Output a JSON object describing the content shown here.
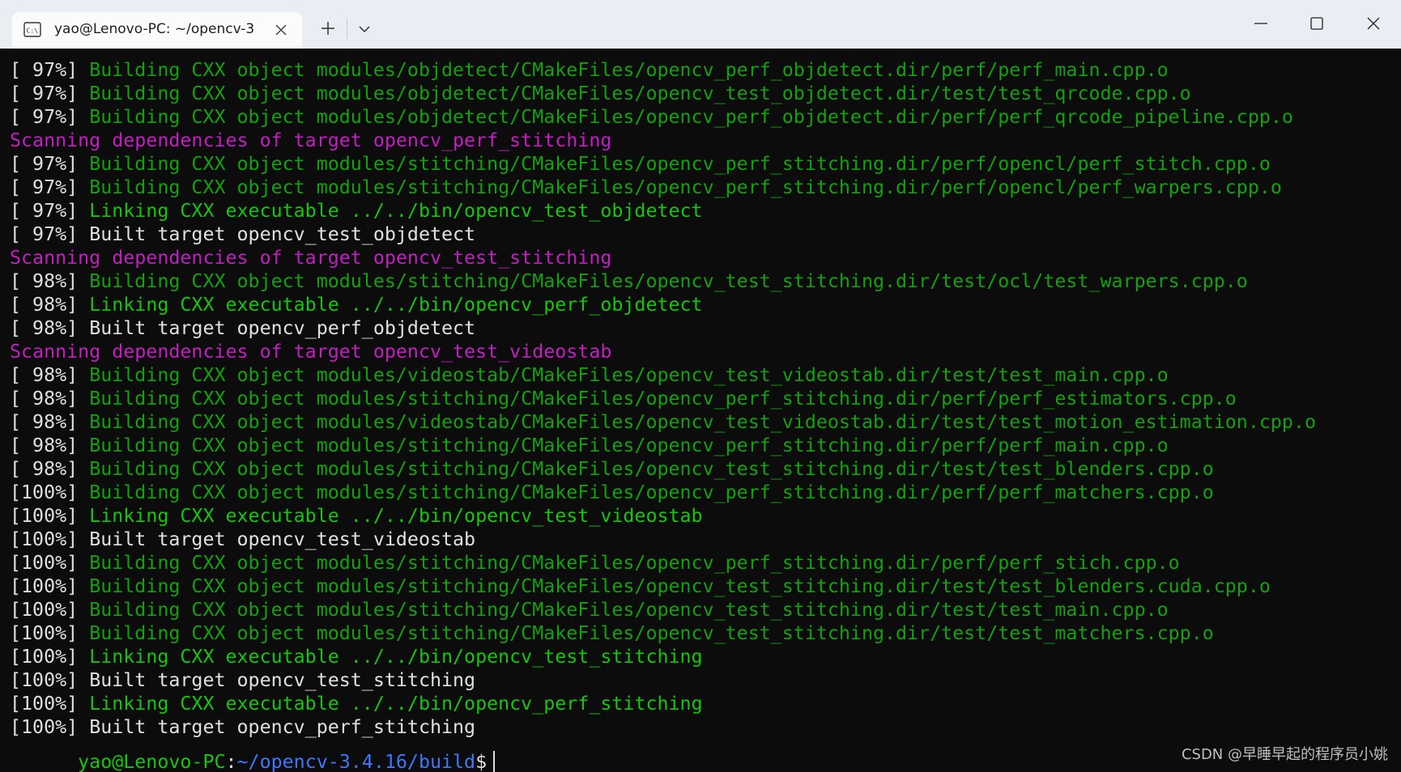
{
  "window": {
    "tab_title": "yao@Lenovo-PC: ~/opencv-3",
    "tab_icon": "terminal-icon",
    "new_tab_icon": "plus-icon",
    "dropdown_icon": "chevron-down-icon",
    "minimize_icon": "minimize-icon",
    "maximize_icon": "maximize-icon",
    "close_icon": "close-icon"
  },
  "colors": {
    "background": "#0c0c0c",
    "text_white": "#e0e0e0",
    "text_green": "#16c60c",
    "text_magenta": "#c21ec2",
    "path_blue": "#3b78ff",
    "titlebar": "#e8eef3"
  },
  "terminal": {
    "lines": [
      {
        "prefix": "[ 97%] ",
        "text": "Building CXX object modules/objdetect/CMakeFiles/opencv_perf_objdetect.dir/perf/perf_main.cpp.o",
        "style": "build"
      },
      {
        "prefix": "[ 97%] ",
        "text": "Building CXX object modules/objdetect/CMakeFiles/opencv_test_objdetect.dir/test/test_qrcode.cpp.o",
        "style": "build"
      },
      {
        "prefix": "[ 97%] ",
        "text": "Building CXX object modules/objdetect/CMakeFiles/opencv_perf_objdetect.dir/perf/perf_qrcode_pipeline.cpp.o",
        "style": "build"
      },
      {
        "prefix": "",
        "text": "Scanning dependencies of target opencv_perf_stitching",
        "style": "scan"
      },
      {
        "prefix": "[ 97%] ",
        "text": "Building CXX object modules/stitching/CMakeFiles/opencv_perf_stitching.dir/perf/opencl/perf_stitch.cpp.o",
        "style": "build"
      },
      {
        "prefix": "[ 97%] ",
        "text": "Building CXX object modules/stitching/CMakeFiles/opencv_perf_stitching.dir/perf/opencl/perf_warpers.cpp.o",
        "style": "build"
      },
      {
        "prefix": "[ 97%] ",
        "text": "Linking CXX executable ../../bin/opencv_test_objdetect",
        "style": "link"
      },
      {
        "prefix": "[ 97%] ",
        "text": "Built target opencv_test_objdetect",
        "style": "built"
      },
      {
        "prefix": "",
        "text": "Scanning dependencies of target opencv_test_stitching",
        "style": "scan"
      },
      {
        "prefix": "[ 98%] ",
        "text": "Building CXX object modules/stitching/CMakeFiles/opencv_test_stitching.dir/test/ocl/test_warpers.cpp.o",
        "style": "build"
      },
      {
        "prefix": "[ 98%] ",
        "text": "Linking CXX executable ../../bin/opencv_perf_objdetect",
        "style": "link"
      },
      {
        "prefix": "[ 98%] ",
        "text": "Built target opencv_perf_objdetect",
        "style": "built"
      },
      {
        "prefix": "",
        "text": "Scanning dependencies of target opencv_test_videostab",
        "style": "scan"
      },
      {
        "prefix": "[ 98%] ",
        "text": "Building CXX object modules/videostab/CMakeFiles/opencv_test_videostab.dir/test/test_main.cpp.o",
        "style": "build"
      },
      {
        "prefix": "[ 98%] ",
        "text": "Building CXX object modules/stitching/CMakeFiles/opencv_perf_stitching.dir/perf/perf_estimators.cpp.o",
        "style": "build"
      },
      {
        "prefix": "[ 98%] ",
        "text": "Building CXX object modules/videostab/CMakeFiles/opencv_test_videostab.dir/test/test_motion_estimation.cpp.o",
        "style": "build"
      },
      {
        "prefix": "[ 98%] ",
        "text": "Building CXX object modules/stitching/CMakeFiles/opencv_perf_stitching.dir/perf/perf_main.cpp.o",
        "style": "build"
      },
      {
        "prefix": "[ 98%] ",
        "text": "Building CXX object modules/stitching/CMakeFiles/opencv_test_stitching.dir/test/test_blenders.cpp.o",
        "style": "build"
      },
      {
        "prefix": "[100%] ",
        "text": "Building CXX object modules/stitching/CMakeFiles/opencv_perf_stitching.dir/perf/perf_matchers.cpp.o",
        "style": "build"
      },
      {
        "prefix": "[100%] ",
        "text": "Linking CXX executable ../../bin/opencv_test_videostab",
        "style": "link"
      },
      {
        "prefix": "[100%] ",
        "text": "Built target opencv_test_videostab",
        "style": "built"
      },
      {
        "prefix": "[100%] ",
        "text": "Building CXX object modules/stitching/CMakeFiles/opencv_perf_stitching.dir/perf/perf_stich.cpp.o",
        "style": "build"
      },
      {
        "prefix": "[100%] ",
        "text": "Building CXX object modules/stitching/CMakeFiles/opencv_test_stitching.dir/test/test_blenders.cuda.cpp.o",
        "style": "build"
      },
      {
        "prefix": "[100%] ",
        "text": "Building CXX object modules/stitching/CMakeFiles/opencv_test_stitching.dir/test/test_main.cpp.o",
        "style": "build"
      },
      {
        "prefix": "[100%] ",
        "text": "Building CXX object modules/stitching/CMakeFiles/opencv_test_stitching.dir/test/test_matchers.cpp.o",
        "style": "build"
      },
      {
        "prefix": "[100%] ",
        "text": "Linking CXX executable ../../bin/opencv_test_stitching",
        "style": "link"
      },
      {
        "prefix": "[100%] ",
        "text": "Built target opencv_test_stitching",
        "style": "built"
      },
      {
        "prefix": "[100%] ",
        "text": "Linking CXX executable ../../bin/opencv_perf_stitching",
        "style": "link"
      },
      {
        "prefix": "[100%] ",
        "text": "Built target opencv_perf_stitching",
        "style": "built"
      }
    ],
    "prompt": {
      "user_host": "yao@Lenovo-PC",
      "separator": ":",
      "path": "~/opencv-3.4.16/build",
      "sign": "$"
    }
  },
  "watermark": "CSDN @早睡早起的程序员小姚"
}
